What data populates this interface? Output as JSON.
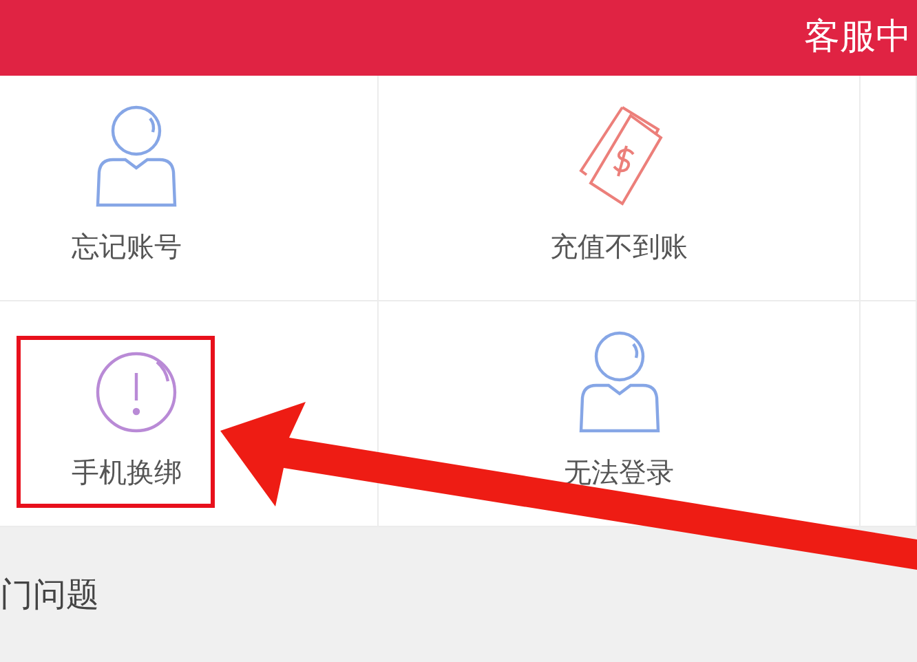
{
  "header": {
    "title": "客服中"
  },
  "grid": [
    {
      "label": "忘记账号",
      "kind": "person",
      "highlighted": false
    },
    {
      "label": "充值不到账",
      "kind": "money",
      "highlighted": false
    },
    {
      "label": "手机换绑",
      "kind": "alert",
      "highlighted": true
    },
    {
      "label": "无法登录",
      "kind": "person",
      "highlighted": false
    }
  ],
  "section": {
    "title": "门问题"
  }
}
